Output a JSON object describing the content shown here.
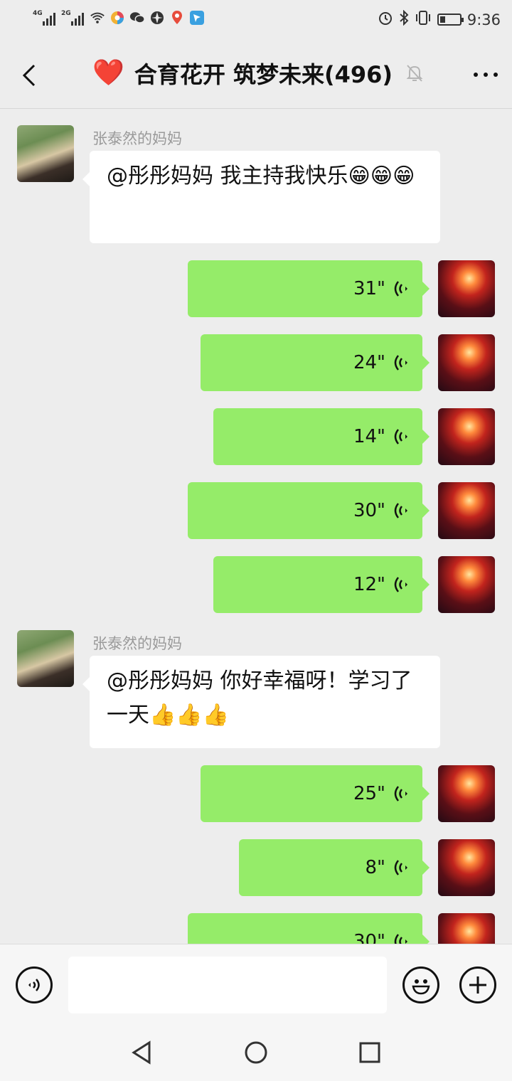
{
  "status_bar": {
    "signal_1_label": "4G",
    "signal_2_label": "2G",
    "time": "9:36",
    "battery_level": 0.25,
    "icons": [
      "signal-icon",
      "signal-icon",
      "wifi-icon",
      "app-icon",
      "wechat-icon",
      "app-icon",
      "location-icon",
      "app-icon",
      "alarm-icon",
      "bluetooth-icon",
      "vibrate-icon",
      "battery-icon"
    ]
  },
  "header": {
    "title": "合育花开 筑梦未来(496)",
    "emoji": "❤️"
  },
  "messages": [
    {
      "sender": "张泰然的妈妈",
      "text": "@彤彤妈妈  我主持我快乐😁😁😁"
    },
    {
      "voice": "31\""
    },
    {
      "voice": "24\""
    },
    {
      "voice": "14\""
    },
    {
      "voice": "30\""
    },
    {
      "voice": "12\""
    },
    {
      "sender": "张泰然的妈妈",
      "text": "@彤彤妈妈  你好幸福呀！学习了一天👍👍👍"
    },
    {
      "voice": "25\""
    },
    {
      "voice": "8\""
    },
    {
      "voice": "30\""
    }
  ],
  "input": {
    "placeholder": ""
  },
  "colors": {
    "background": "#ededed",
    "outgoing_bubble": "#95ec69",
    "incoming_bubble": "#ffffff"
  }
}
